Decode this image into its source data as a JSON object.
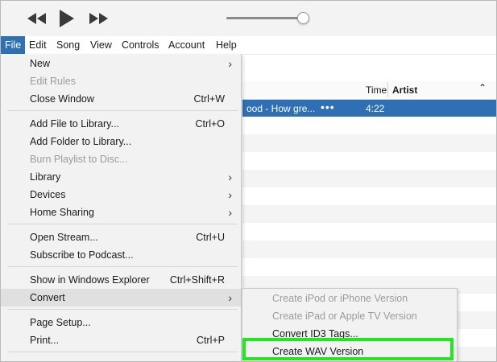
{
  "player": {
    "icons": [
      "rewind-icon",
      "play-icon",
      "fast-forward-icon"
    ],
    "volume_level": 0.92
  },
  "menubar": {
    "items": [
      "File",
      "Edit",
      "Song",
      "View",
      "Controls",
      "Account",
      "Help"
    ],
    "active": "File"
  },
  "list": {
    "header_time": "Time",
    "header_artist": "Artist",
    "selected_title": "ood - How gre...",
    "selected_time": "4:22",
    "more_icon": "ellipsis-icon"
  },
  "file_menu": {
    "items": [
      {
        "label": "New",
        "shortcut": "",
        "submenu": true,
        "disabled": false
      },
      {
        "label": "Edit Rules",
        "shortcut": "",
        "submenu": false,
        "disabled": true
      },
      {
        "label": "Close Window",
        "shortcut": "Ctrl+W",
        "submenu": false,
        "disabled": false
      },
      {
        "label": "Add File to Library...",
        "shortcut": "Ctrl+O",
        "submenu": false,
        "disabled": false
      },
      {
        "label": "Add Folder to Library...",
        "shortcut": "",
        "submenu": false,
        "disabled": false
      },
      {
        "label": "Burn Playlist to Disc...",
        "shortcut": "",
        "submenu": false,
        "disabled": true
      },
      {
        "label": "Library",
        "shortcut": "",
        "submenu": true,
        "disabled": false
      },
      {
        "label": "Devices",
        "shortcut": "",
        "submenu": true,
        "disabled": false
      },
      {
        "label": "Home Sharing",
        "shortcut": "",
        "submenu": true,
        "disabled": false
      },
      {
        "label": "Open Stream...",
        "shortcut": "Ctrl+U",
        "submenu": false,
        "disabled": false
      },
      {
        "label": "Subscribe to Podcast...",
        "shortcut": "",
        "submenu": false,
        "disabled": false
      },
      {
        "label": "Show in Windows Explorer",
        "shortcut": "Ctrl+Shift+R",
        "submenu": false,
        "disabled": false
      },
      {
        "label": "Convert",
        "shortcut": "",
        "submenu": true,
        "disabled": false
      },
      {
        "label": "Page Setup...",
        "shortcut": "",
        "submenu": false,
        "disabled": false
      },
      {
        "label": "Print...",
        "shortcut": "Ctrl+P",
        "submenu": false,
        "disabled": false
      }
    ]
  },
  "convert_menu": {
    "items": [
      {
        "label": "Create iPod or iPhone Version",
        "disabled": true
      },
      {
        "label": "Create iPad or Apple TV Version",
        "disabled": true
      },
      {
        "label": "Convert ID3 Tags...",
        "disabled": false
      },
      {
        "label": "Create WAV Version",
        "disabled": false
      }
    ],
    "highlight_color": "#22e61e"
  },
  "colors": {
    "selection": "#2f6fb4",
    "menu_bg": "#f2f2f2",
    "disabled_text": "#9c9c9c"
  }
}
